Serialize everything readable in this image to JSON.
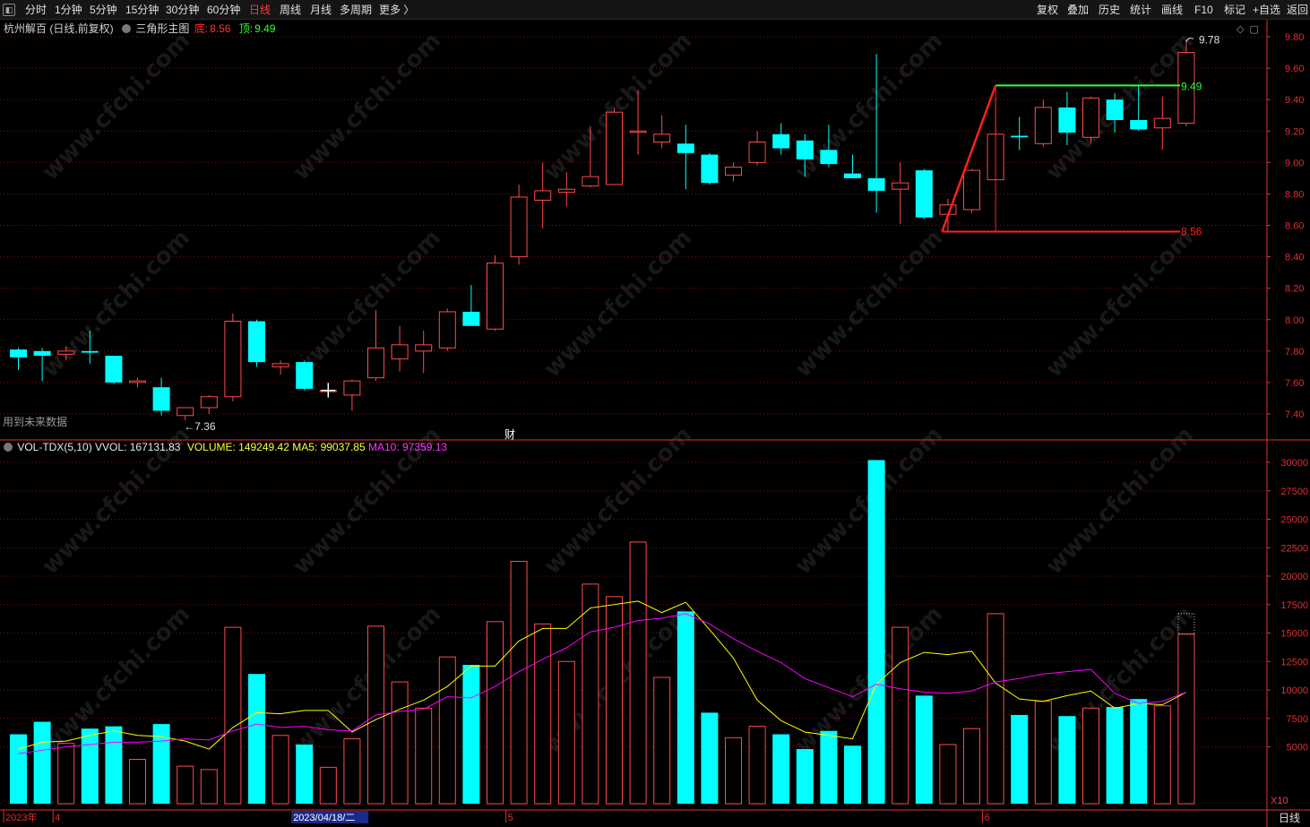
{
  "toolbar": {
    "left": [
      "分时",
      "1分钟",
      "5分钟",
      "15分钟",
      "30分钟",
      "60分钟",
      "日线",
      "周线",
      "月线",
      "多周期",
      "更多 〉"
    ],
    "active": "日线",
    "right": [
      "复权",
      "叠加",
      "历史",
      "统计",
      "画线",
      "F10",
      "标记",
      "+自选",
      "返回"
    ]
  },
  "header": {
    "title": "杭州解百 (日线,前复权)",
    "indicator": "三角形主图",
    "bottom_label": "底:",
    "bottom_value": "8.56",
    "top_label": "顶:",
    "top_value": "9.49"
  },
  "volume_header": {
    "name": "VOL-TDX(5,10)",
    "vvol": "VVOL: 167131.83",
    "volume": "VOLUME: 149249.42",
    "ma5": "MA5: 99037.85",
    "ma10": "MA10: 97359.13"
  },
  "notes": {
    "future_data": "用到未来数据",
    "finance_mark": "财",
    "low_marker": "←7.36",
    "high_marker": "9.78",
    "pattern_top": "9.49",
    "pattern_bottom": "8.56",
    "watermark": "www.cfchi.com"
  },
  "x_axis": {
    "labels": [
      {
        "text": "2023年",
        "index": 0
      },
      {
        "text": "4",
        "index": 2
      },
      {
        "text": "2023/04/18/二",
        "index": 12,
        "highlight": true
      },
      {
        "text": "5",
        "index": 21
      },
      {
        "text": "6",
        "index": 41
      }
    ],
    "period": "日线",
    "multiplier": "X10"
  },
  "colors": {
    "up": "#ff4a4a",
    "down": "#00ffff",
    "ma5": "#ffff00",
    "ma10": "#ff00ff",
    "grid": "#7a1010",
    "axis": "#e03030",
    "pattern_line": "#ff2020",
    "pattern_top_line": "#33ff33"
  },
  "chart_data": {
    "type": "candlestick",
    "price_axis": {
      "ticks": [
        7.4,
        7.6,
        7.8,
        8.0,
        8.2,
        8.4,
        8.6,
        8.8,
        9.0,
        9.2,
        9.4,
        9.6,
        9.8
      ],
      "ylim": [
        7.24,
        9.88
      ]
    },
    "volume_axis": {
      "ticks": [
        5000,
        7500,
        10000,
        12500,
        15000,
        17500,
        20000,
        22500,
        25000,
        27500,
        30000
      ],
      "ylim": [
        0,
        31000
      ]
    },
    "candles": [
      {
        "o": 7.81,
        "h": 7.82,
        "l": 7.68,
        "c": 7.76
      },
      {
        "o": 7.8,
        "h": 7.82,
        "l": 7.61,
        "c": 7.77
      },
      {
        "o": 7.78,
        "h": 7.83,
        "l": 7.74,
        "c": 7.8
      },
      {
        "o": 7.8,
        "h": 7.93,
        "l": 7.72,
        "c": 7.79
      },
      {
        "o": 7.77,
        "h": 7.77,
        "l": 7.59,
        "c": 7.6
      },
      {
        "o": 7.6,
        "h": 7.63,
        "l": 7.57,
        "c": 7.61
      },
      {
        "o": 7.57,
        "h": 7.63,
        "l": 7.39,
        "c": 7.42
      },
      {
        "o": 7.39,
        "h": 7.44,
        "l": 7.36,
        "c": 7.44
      },
      {
        "o": 7.44,
        "h": 7.52,
        "l": 7.4,
        "c": 7.51
      },
      {
        "o": 7.51,
        "h": 8.04,
        "l": 7.48,
        "c": 7.99
      },
      {
        "o": 7.99,
        "h": 8.0,
        "l": 7.7,
        "c": 7.73
      },
      {
        "o": 7.7,
        "h": 7.74,
        "l": 7.65,
        "c": 7.72
      },
      {
        "o": 7.73,
        "h": 7.74,
        "l": 7.55,
        "c": 7.56
      },
      {
        "o": 7.55,
        "h": 7.6,
        "l": 7.52,
        "c": 7.55
      },
      {
        "o": 7.52,
        "h": 7.62,
        "l": 7.42,
        "c": 7.61
      },
      {
        "o": 7.63,
        "h": 8.06,
        "l": 7.61,
        "c": 7.82
      },
      {
        "o": 7.75,
        "h": 7.96,
        "l": 7.67,
        "c": 7.84
      },
      {
        "o": 7.8,
        "h": 7.93,
        "l": 7.66,
        "c": 7.84
      },
      {
        "o": 7.82,
        "h": 8.07,
        "l": 7.8,
        "c": 8.05
      },
      {
        "o": 8.05,
        "h": 8.22,
        "l": 7.97,
        "c": 7.96
      },
      {
        "o": 7.94,
        "h": 8.41,
        "l": 7.93,
        "c": 8.36
      },
      {
        "o": 8.4,
        "h": 8.86,
        "l": 8.35,
        "c": 8.78
      },
      {
        "o": 8.76,
        "h": 9.0,
        "l": 8.58,
        "c": 8.82
      },
      {
        "o": 8.81,
        "h": 8.94,
        "l": 8.72,
        "c": 8.83
      },
      {
        "o": 8.85,
        "h": 9.23,
        "l": 8.84,
        "c": 8.91
      },
      {
        "o": 8.86,
        "h": 9.35,
        "l": 8.86,
        "c": 9.32
      },
      {
        "o": 9.2,
        "h": 9.46,
        "l": 9.05,
        "c": 9.2
      },
      {
        "o": 9.13,
        "h": 9.3,
        "l": 9.09,
        "c": 9.18
      },
      {
        "o": 9.12,
        "h": 9.24,
        "l": 8.83,
        "c": 9.06
      },
      {
        "o": 9.05,
        "h": 9.06,
        "l": 8.86,
        "c": 8.87
      },
      {
        "o": 8.92,
        "h": 9.0,
        "l": 8.88,
        "c": 8.97
      },
      {
        "o": 9.0,
        "h": 9.2,
        "l": 8.98,
        "c": 9.13
      },
      {
        "o": 9.18,
        "h": 9.25,
        "l": 9.05,
        "c": 9.09
      },
      {
        "o": 9.14,
        "h": 9.18,
        "l": 8.91,
        "c": 9.02
      },
      {
        "o": 9.08,
        "h": 9.24,
        "l": 8.97,
        "c": 8.99
      },
      {
        "o": 8.93,
        "h": 9.05,
        "l": 8.9,
        "c": 8.9
      },
      {
        "o": 8.9,
        "h": 9.69,
        "l": 8.68,
        "c": 8.82
      },
      {
        "o": 8.83,
        "h": 9.0,
        "l": 8.61,
        "c": 8.87
      },
      {
        "o": 8.95,
        "h": 8.96,
        "l": 8.64,
        "c": 8.65
      },
      {
        "o": 8.67,
        "h": 8.77,
        "l": 8.56,
        "c": 8.73
      },
      {
        "o": 8.7,
        "h": 8.96,
        "l": 8.68,
        "c": 8.95
      },
      {
        "o": 8.89,
        "h": 9.41,
        "l": 8.89,
        "c": 9.18
      },
      {
        "o": 9.17,
        "h": 9.29,
        "l": 9.08,
        "c": 9.16
      },
      {
        "o": 9.12,
        "h": 9.4,
        "l": 9.1,
        "c": 9.35
      },
      {
        "o": 9.35,
        "h": 9.45,
        "l": 9.11,
        "c": 9.19
      },
      {
        "o": 9.16,
        "h": 9.42,
        "l": 9.12,
        "c": 9.41
      },
      {
        "o": 9.4,
        "h": 9.44,
        "l": 9.19,
        "c": 9.27
      },
      {
        "o": 9.27,
        "h": 9.49,
        "l": 9.2,
        "c": 9.21
      },
      {
        "o": 9.22,
        "h": 9.42,
        "l": 9.08,
        "c": 9.28
      },
      {
        "o": 9.25,
        "h": 9.78,
        "l": 9.23,
        "c": 9.7
      }
    ],
    "volume": [
      6100,
      7200,
      5300,
      6600,
      6800,
      3900,
      7000,
      3300,
      3000,
      15500,
      11400,
      6000,
      5200,
      3200,
      5700,
      15600,
      10700,
      8400,
      12900,
      12200,
      16000,
      21300,
      15800,
      12500,
      19300,
      18200,
      23000,
      11100,
      16900,
      8000,
      5800,
      6800,
      6100,
      4800,
      6400,
      5100,
      30200,
      15500,
      9500,
      5200,
      6600,
      16700,
      7800,
      9000,
      7700,
      8400,
      8500,
      9200,
      8600,
      14900
    ],
    "ma5": [
      4800,
      5400,
      5500,
      6000,
      6400,
      6000,
      5900,
      5500,
      4800,
      6700,
      8000,
      7900,
      8200,
      8200,
      6300,
      7400,
      8300,
      9100,
      10300,
      12100,
      12100,
      14300,
      15400,
      15400,
      17200,
      17500,
      17800,
      16800,
      17700,
      15300,
      12800,
      9100,
      7300,
      6300,
      6000,
      5700,
      10500,
      12400,
      13300,
      13100,
      13400,
      10600,
      9200,
      9000,
      9500,
      9900,
      8400,
      8800,
      8700,
      9800
    ],
    "ma10": [
      4400,
      4700,
      5000,
      5200,
      5400,
      5400,
      5500,
      5700,
      5600,
      6400,
      7000,
      6700,
      6800,
      6500,
      6400,
      7800,
      8100,
      8300,
      9400,
      9300,
      10300,
      11600,
      12700,
      13700,
      15100,
      15500,
      16100,
      16300,
      16700,
      15800,
      14500,
      13400,
      12400,
      11000,
      10200,
      9400,
      10500,
      10100,
      9800,
      9700,
      9900,
      10700,
      11000,
      11400,
      11600,
      11800,
      9700,
      8800,
      9000,
      9800
    ]
  }
}
